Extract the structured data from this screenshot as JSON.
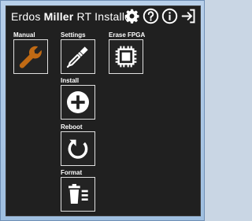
{
  "window": {
    "title_prefix": "Erdos",
    "title_bold": "Miller",
    "title_suffix": "RT Installer"
  },
  "header_icons": [
    "gear-icon",
    "help-icon",
    "info-icon",
    "exit-icon"
  ],
  "tiles": [
    {
      "label": "Manual",
      "icon": "wrench-icon",
      "accent": "#c06a14"
    },
    {
      "label": "Settings",
      "icon": "screwdriver-icon"
    },
    {
      "label": "Erase FPGA",
      "icon": "chip-icon"
    },
    {
      "label": "Install",
      "icon": "plus-circle-icon"
    },
    {
      "label": "Reboot",
      "icon": "reboot-icon"
    },
    {
      "label": "Format",
      "icon": "trash-icon"
    }
  ],
  "colors": {
    "panel": "#202020",
    "text": "#ffffff",
    "wrench": "#c06a14"
  }
}
